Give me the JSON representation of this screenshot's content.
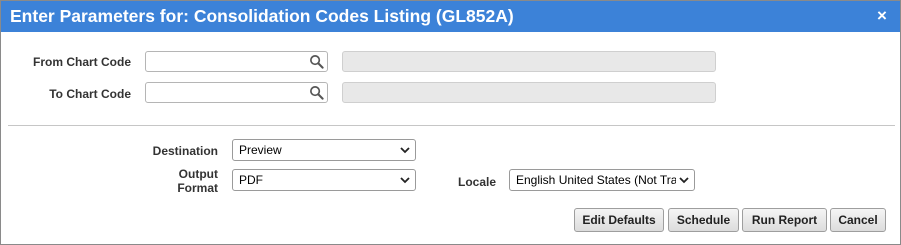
{
  "dialog": {
    "title": "Enter Parameters for: Consolidation Codes Listing (GL852A)",
    "close_symbol": "×"
  },
  "params": {
    "from_chart_code": {
      "label": "From Chart Code",
      "value": "",
      "description": ""
    },
    "to_chart_code": {
      "label": "To Chart Code",
      "value": "",
      "description": ""
    }
  },
  "output": {
    "destination": {
      "label": "Destination",
      "selected": "Preview"
    },
    "output_format": {
      "label_line1": "Output",
      "label_line2": "Format",
      "selected": "PDF"
    },
    "locale": {
      "label": "Locale",
      "selected": "English United States (Not Tra"
    }
  },
  "buttons": {
    "edit_defaults": "Edit Defaults",
    "schedule": "Schedule",
    "run_report": "Run Report",
    "cancel": "Cancel"
  },
  "icons": {
    "lookup": "magnifier-icon",
    "dropdown": "chevron-down-icon",
    "close": "close-icon"
  },
  "colors": {
    "title_bar": "#3c82d8",
    "title_text": "#ffffff",
    "readonly_field": "#e8e8e8"
  }
}
